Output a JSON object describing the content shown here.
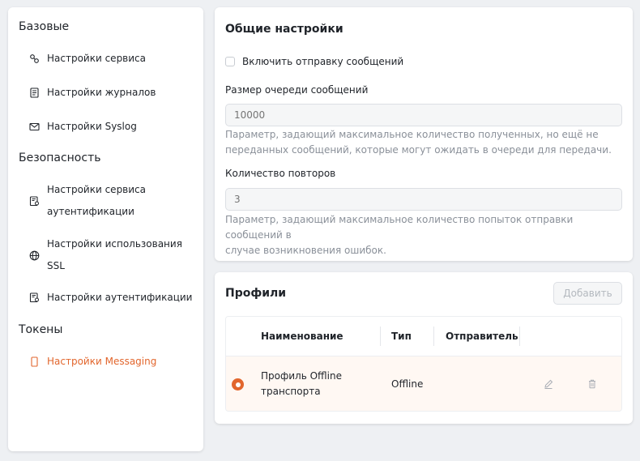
{
  "sidebar": {
    "groups": [
      {
        "title": "Базовые",
        "items": [
          {
            "label": "Настройки сервиса",
            "icon": "services-icon"
          },
          {
            "label": "Настройки журналов",
            "icon": "log-document-icon"
          },
          {
            "label": "Настройки Syslog",
            "icon": "envelope-icon"
          }
        ]
      },
      {
        "title": "Безопасность",
        "items": [
          {
            "label_lines": [
              "Настройки сервиса",
              "аутентификации"
            ],
            "icon": "certificate-icon"
          },
          {
            "label_lines": [
              "Настройки использования",
              "SSL"
            ],
            "icon": "globe-icon"
          },
          {
            "label": "Настройки аутентификации",
            "icon": "certificate-icon"
          }
        ]
      },
      {
        "title": "Токены",
        "items": [
          {
            "label": "Настройки Messaging",
            "icon": "mobile-icon",
            "active": true
          }
        ]
      }
    ]
  },
  "settings": {
    "title": "Общие настройки",
    "enable_sending_label": "Включить отправку сообщений",
    "enable_sending_checked": false,
    "queue_size": {
      "label": "Размер очереди сообщений",
      "value": "10000",
      "hint_lines": [
        "Параметр, задающий максимальное количество полученных, но ещё не",
        "переданных сообщений, которые могут ожидать в очереди для передачи."
      ]
    },
    "retries": {
      "label": "Количество повторов",
      "value": "3",
      "hint_lines": [
        "Параметр, задающий максимальное количество попыток отправки сообщений в",
        "случае возникновения ошибок."
      ]
    }
  },
  "profiles": {
    "title": "Профили",
    "add_label": "Добавить",
    "columns": [
      "Наименование",
      "Тип",
      "Отправитель"
    ],
    "rows": [
      {
        "name_lines": [
          "Профиль Offline",
          "транспорта"
        ],
        "type": "Offline",
        "sender": "",
        "selected": true
      }
    ]
  },
  "colors": {
    "accent": "#e2662d",
    "background": "#eef0f3",
    "selected_row": "#fff8f3"
  }
}
